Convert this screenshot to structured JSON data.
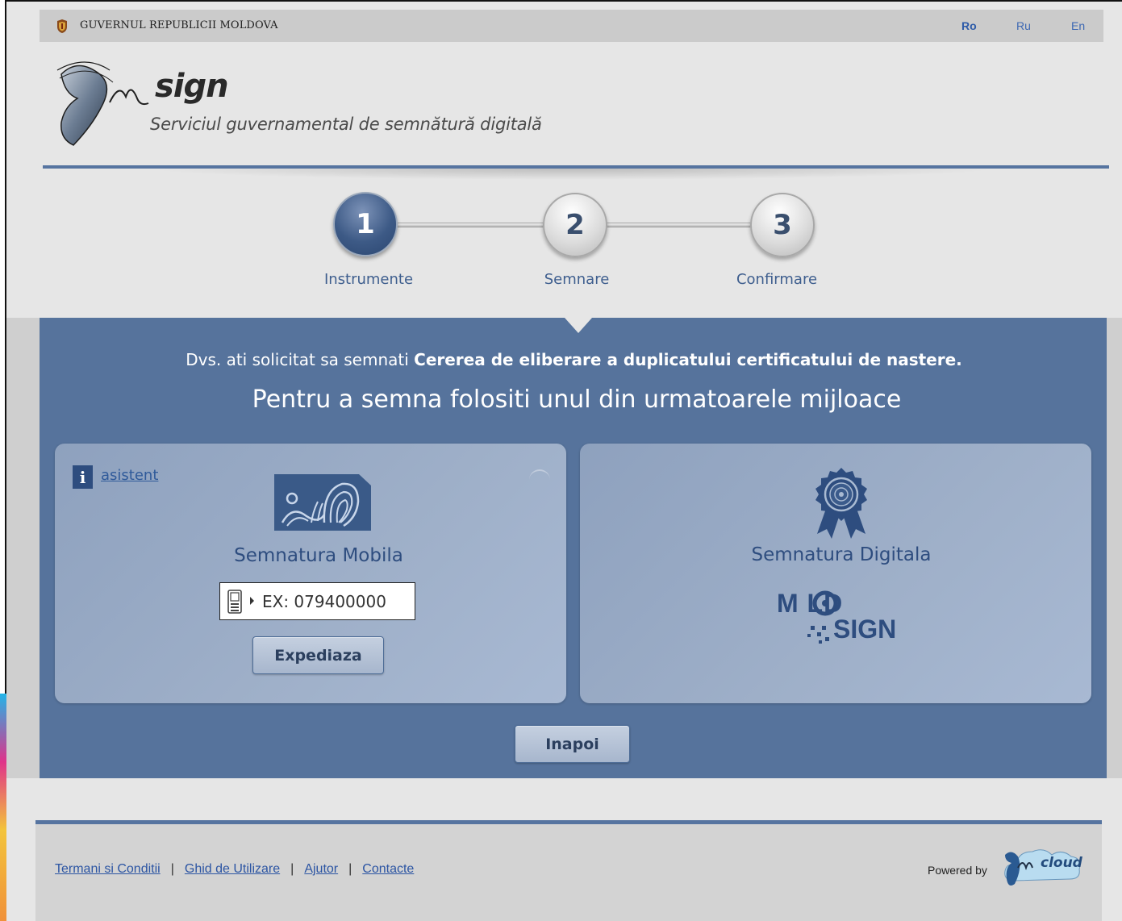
{
  "header": {
    "government_name": "GUVERNUL REPUBLICII MOLDOVA",
    "languages": [
      {
        "label": "Ro",
        "active": true
      },
      {
        "label": "Ru",
        "active": false
      },
      {
        "label": "En",
        "active": false
      }
    ],
    "logo_word": "sign",
    "logo_tagline": "Serviciul guvernamental de semnătură digitală"
  },
  "steps": [
    {
      "number": "1",
      "label": "Instrumente",
      "active": true
    },
    {
      "number": "2",
      "label": "Semnare",
      "active": false
    },
    {
      "number": "3",
      "label": "Confirmare",
      "active": false
    }
  ],
  "main": {
    "request_prefix": "Dvs. ati solicitat sa semnati ",
    "request_document": "Cererea de eliberare a duplicatului certificatului de nastere.",
    "choose_text": "Pentru a semna folositi unul din urmatoarele mijloace",
    "mobile": {
      "assistant_label": "asistent",
      "title": "Semnatura Mobila",
      "phone_placeholder": "EX: 079400000",
      "send_button": "Expediaza"
    },
    "digital": {
      "title": "Semnatura Digitala",
      "brand_top": "M LD",
      "brand_bottom": "SIGN"
    },
    "back_button": "Inapoi"
  },
  "footer": {
    "links": [
      "Termani si Conditii",
      "Ghid de Utilizare",
      "Ajutor",
      "Contacte"
    ],
    "powered_by": "Powered by",
    "cloud_logo_text": "cloud"
  },
  "colors": {
    "panel_blue": "#56739c",
    "accent_dark_blue": "#2e4d7f",
    "link_blue": "#2c55a3"
  }
}
